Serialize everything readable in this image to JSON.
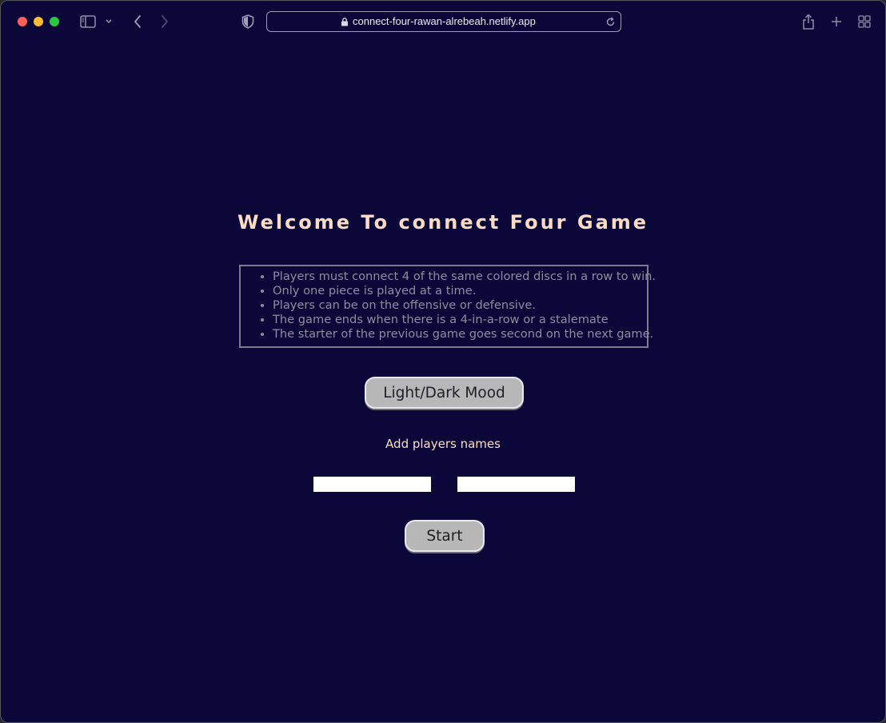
{
  "browser": {
    "url": "connect-four-rawan-alrebeah.netlify.app",
    "icons": {
      "close": "close-dot",
      "minimize": "minimize-dot",
      "zoom": "zoom-dot",
      "sidebar": "sidebar-icon",
      "sidebar_menu": "chevron-down-icon",
      "back": "chevron-left-icon",
      "forward": "chevron-right-icon",
      "privacy": "shield-icon",
      "secure": "lock-icon",
      "reload": "reload-icon",
      "share": "share-icon",
      "new_tab": "plus-icon",
      "tab_overview": "grid-icon"
    },
    "colors": {
      "close": "#fe5f57",
      "minimize": "#febc2e",
      "zoom": "#28c840",
      "toolbar_bg": "#0b0839"
    }
  },
  "page": {
    "title": "Welcome To connect Four Game",
    "rules": [
      "Players must connect 4 of the same colored discs in a row to win.",
      "Only one piece is played at a time.",
      "Players can be on the offensive or defensive.",
      "The game ends when there is a 4-in-a-row or a stalemate",
      "The starter of the previous game goes second on the next game."
    ],
    "mood_button": "Light/Dark Mood",
    "players_label": "Add players names",
    "player1_value": "",
    "player2_value": "",
    "start_button": "Start",
    "colors": {
      "background": "#0b0839",
      "title": "#fbdcc3",
      "rules_text": "#8d8d9e",
      "button_bg": "#b7b7b7"
    }
  }
}
